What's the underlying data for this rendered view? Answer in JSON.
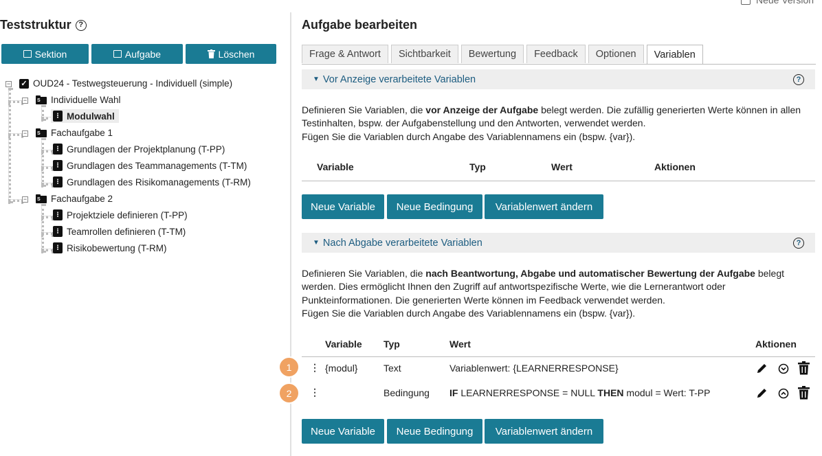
{
  "top": {
    "checkbox_label": "Neue Version"
  },
  "left": {
    "title": "Teststruktur",
    "toolbar": {
      "section_label": "Sektion",
      "question_label": "Aufgabe",
      "delete_label": "Löschen"
    },
    "tree": {
      "root": "OUD24 - Testwegsteuerung - Individuell (simple)",
      "sections": [
        {
          "label": "Individuelle Wahl",
          "items": [
            "Modulwahl"
          ]
        },
        {
          "label": "Fachaufgabe 1",
          "items": [
            "Grundlagen der Projektplanung (T-PP)",
            "Grundlagen des Teammanagements (T-TM)",
            "Grundlagen des Risikomanagements (T-RM)"
          ]
        },
        {
          "label": "Fachaufgabe 2",
          "items": [
            "Projektziele definieren (T-PP)",
            "Teamrollen definieren (T-TM)",
            "Risikobewertung (T-RM)"
          ]
        }
      ]
    }
  },
  "right": {
    "title": "Aufgabe bearbeiten",
    "tabs": [
      "Frage & Antwort",
      "Sichtbarkeit",
      "Bewertung",
      "Feedback",
      "Optionen",
      "Variablen"
    ],
    "active_tab": "Variablen",
    "pre": {
      "header": "Vor Anzeige verarbeitete Variablen",
      "desc_1": "Definieren Sie Variablen, die ",
      "desc_bold": "vor Anzeige der Aufgabe",
      "desc_2": " belegt werden. Die zufällig generierten Werte können in allen Testinhalten, bspw. der Aufgabenstellung und den Antworten, verwendet werden.",
      "desc_3": "Fügen Sie die Variablen durch Angabe des Variablennamens ein (bspw. {var}).",
      "columns": {
        "variable": "Variable",
        "typ": "Typ",
        "wert": "Wert",
        "aktionen": "Aktionen"
      }
    },
    "post": {
      "header": "Nach Abgabe verarbeitete Variablen",
      "desc_1": "Definieren Sie Variablen, die ",
      "desc_bold": "nach Beantwortung, Abgabe und automatischer Bewertung der Aufgabe",
      "desc_2": " belegt werden. Dies ermöglicht Ihnen den Zugriff auf antwortspezifische Werte, wie die Lernerantwort oder Punkteinformationen. Die generierten Werte können im Feedback verwendet werden.",
      "desc_3": "Fügen Sie die Variablen durch Angabe des Variablennamens ein (bspw. {var}).",
      "columns": {
        "variable": "Variable",
        "typ": "Typ",
        "wert": "Wert",
        "aktionen": "Aktionen"
      },
      "rows": [
        {
          "badge": "1",
          "variable": "{modul}",
          "typ": "Text",
          "wert": "Variablenwert: {LEARNERRESPONSE}"
        },
        {
          "badge": "2",
          "variable": "",
          "typ": "Bedingung",
          "if_kw": "IF",
          "cond": " LEARNERRESPONSE = NULL ",
          "then_kw": "THEN",
          "result": " modul = Wert: T-PP"
        }
      ]
    },
    "buttons": {
      "new_variable": "Neue Variable",
      "new_condition": "Neue Bedingung",
      "change_value": "Variablenwert ändern"
    }
  }
}
